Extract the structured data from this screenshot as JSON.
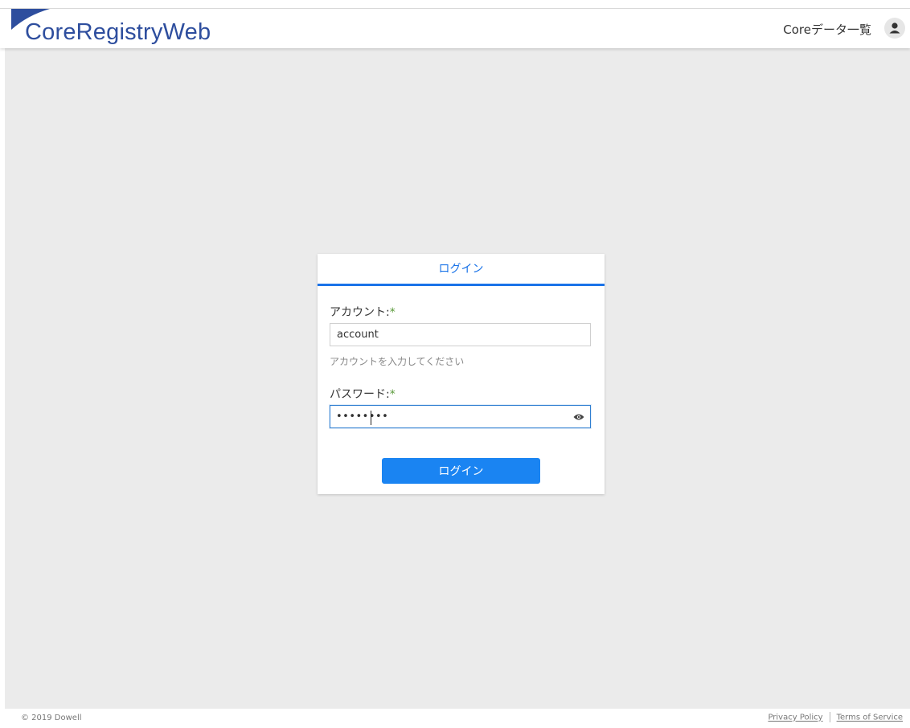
{
  "header": {
    "logo_text": "CoreRegistryWeb",
    "nav_link": "Coreデータ一覧",
    "brand_color": "#2e4e9e"
  },
  "login": {
    "title": "ログイン",
    "account_label": "アカウント:",
    "account_value": "account",
    "account_hint": "アカウントを入力してください",
    "password_label": "パスワード:",
    "password_masked": "••••••••",
    "required_mark": "*",
    "submit_label": "ログイン",
    "accent_color": "#1a73e8",
    "button_color": "#1a84f2"
  },
  "footer": {
    "copyright": "© 2019 Dowell",
    "privacy": "Privacy Policy",
    "terms": "Terms of Service"
  },
  "icons": {
    "user": "user-avatar-icon",
    "password_toggle": "eye-icon",
    "logo": "logo-flag-icon"
  }
}
